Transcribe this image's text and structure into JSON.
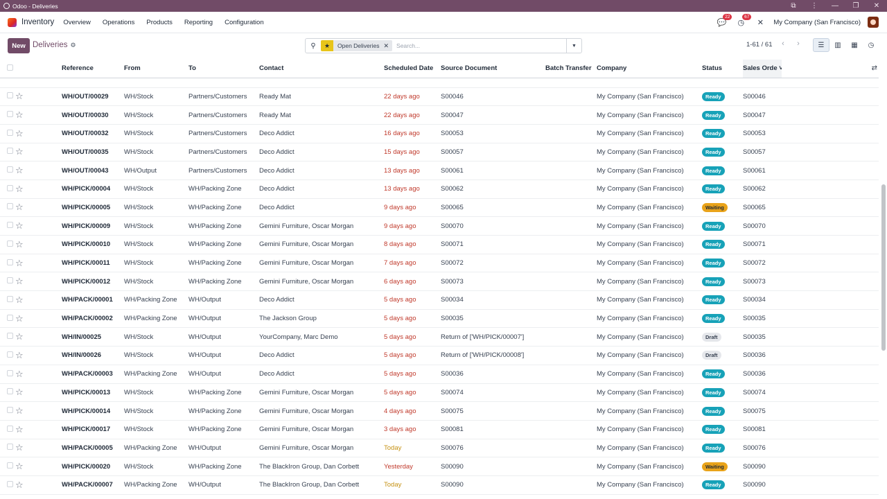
{
  "window": {
    "title": "Odoo - Deliveries"
  },
  "nav": {
    "app_name": "Inventory",
    "menu": [
      "Overview",
      "Operations",
      "Products",
      "Reporting",
      "Configuration"
    ],
    "messages_count": "22",
    "activities_count": "67",
    "company": "My Company (San Francisco)"
  },
  "control": {
    "new_label": "New",
    "breadcrumb": "Deliveries",
    "facet_label": "Open Deliveries",
    "search_placeholder": "Search...",
    "pager": "1-61 / 61"
  },
  "columns": [
    "Reference",
    "From",
    "To",
    "Contact",
    "Scheduled Date",
    "Source Document",
    "Batch Transfer",
    "Company",
    "Status",
    "Sales Orde"
  ],
  "rows": [
    {
      "ref": "WH/OUT/00029",
      "from": "WH/Stock",
      "to": "Partners/Customers",
      "contact": "Ready Mat",
      "date": "22 days ago",
      "date_kind": "overdue",
      "source": "S00046",
      "company": "My Company (San Francisco)",
      "status": "Ready",
      "status_kind": "ready",
      "so": "S00046"
    },
    {
      "ref": "WH/OUT/00030",
      "from": "WH/Stock",
      "to": "Partners/Customers",
      "contact": "Ready Mat",
      "date": "22 days ago",
      "date_kind": "overdue",
      "source": "S00047",
      "company": "My Company (San Francisco)",
      "status": "Ready",
      "status_kind": "ready",
      "so": "S00047"
    },
    {
      "ref": "WH/OUT/00032",
      "from": "WH/Stock",
      "to": "Partners/Customers",
      "contact": "Deco Addict",
      "date": "16 days ago",
      "date_kind": "overdue",
      "source": "S00053",
      "company": "My Company (San Francisco)",
      "status": "Ready",
      "status_kind": "ready",
      "so": "S00053"
    },
    {
      "ref": "WH/OUT/00035",
      "from": "WH/Stock",
      "to": "Partners/Customers",
      "contact": "Deco Addict",
      "date": "15 days ago",
      "date_kind": "overdue",
      "source": "S00057",
      "company": "My Company (San Francisco)",
      "status": "Ready",
      "status_kind": "ready",
      "so": "S00057"
    },
    {
      "ref": "WH/OUT/00043",
      "from": "WH/Output",
      "to": "Partners/Customers",
      "contact": "Deco Addict",
      "date": "13 days ago",
      "date_kind": "overdue",
      "source": "S00061",
      "company": "My Company (San Francisco)",
      "status": "Ready",
      "status_kind": "ready",
      "so": "S00061"
    },
    {
      "ref": "WH/PICK/00004",
      "from": "WH/Stock",
      "to": "WH/Packing Zone",
      "contact": "Deco Addict",
      "date": "13 days ago",
      "date_kind": "overdue",
      "source": "S00062",
      "company": "My Company (San Francisco)",
      "status": "Ready",
      "status_kind": "ready",
      "so": "S00062"
    },
    {
      "ref": "WH/PICK/00005",
      "from": "WH/Stock",
      "to": "WH/Packing Zone",
      "contact": "Deco Addict",
      "date": "9 days ago",
      "date_kind": "overdue",
      "source": "S00065",
      "company": "My Company (San Francisco)",
      "status": "Waiting",
      "status_kind": "waiting",
      "so": "S00065"
    },
    {
      "ref": "WH/PICK/00009",
      "from": "WH/Stock",
      "to": "WH/Packing Zone",
      "contact": "Gemini Furniture, Oscar Morgan",
      "date": "9 days ago",
      "date_kind": "overdue",
      "source": "S00070",
      "company": "My Company (San Francisco)",
      "status": "Ready",
      "status_kind": "ready",
      "so": "S00070"
    },
    {
      "ref": "WH/PICK/00010",
      "from": "WH/Stock",
      "to": "WH/Packing Zone",
      "contact": "Gemini Furniture, Oscar Morgan",
      "date": "8 days ago",
      "date_kind": "overdue",
      "source": "S00071",
      "company": "My Company (San Francisco)",
      "status": "Ready",
      "status_kind": "ready",
      "so": "S00071"
    },
    {
      "ref": "WH/PICK/00011",
      "from": "WH/Stock",
      "to": "WH/Packing Zone",
      "contact": "Gemini Furniture, Oscar Morgan",
      "date": "7 days ago",
      "date_kind": "overdue",
      "source": "S00072",
      "company": "My Company (San Francisco)",
      "status": "Ready",
      "status_kind": "ready",
      "so": "S00072"
    },
    {
      "ref": "WH/PICK/00012",
      "from": "WH/Stock",
      "to": "WH/Packing Zone",
      "contact": "Gemini Furniture, Oscar Morgan",
      "date": "6 days ago",
      "date_kind": "overdue",
      "source": "S00073",
      "company": "My Company (San Francisco)",
      "status": "Ready",
      "status_kind": "ready",
      "so": "S00073"
    },
    {
      "ref": "WH/PACK/00001",
      "from": "WH/Packing Zone",
      "to": "WH/Output",
      "contact": "Deco Addict",
      "date": "5 days ago",
      "date_kind": "overdue",
      "source": "S00034",
      "company": "My Company (San Francisco)",
      "status": "Ready",
      "status_kind": "ready",
      "so": "S00034"
    },
    {
      "ref": "WH/PACK/00002",
      "from": "WH/Packing Zone",
      "to": "WH/Output",
      "contact": "The Jackson Group",
      "date": "5 days ago",
      "date_kind": "overdue",
      "source": "S00035",
      "company": "My Company (San Francisco)",
      "status": "Ready",
      "status_kind": "ready",
      "so": "S00035"
    },
    {
      "ref": "WH/IN/00025",
      "from": "WH/Stock",
      "to": "WH/Output",
      "contact": "YourCompany, Marc Demo",
      "date": "5 days ago",
      "date_kind": "overdue",
      "source": "Return of ['WH/PICK/00007']",
      "company": "My Company (San Francisco)",
      "status": "Draft",
      "status_kind": "draft",
      "so": "S00035"
    },
    {
      "ref": "WH/IN/00026",
      "from": "WH/Stock",
      "to": "WH/Output",
      "contact": "Deco Addict",
      "date": "5 days ago",
      "date_kind": "overdue",
      "source": "Return of ['WH/PICK/00008']",
      "company": "My Company (San Francisco)",
      "status": "Draft",
      "status_kind": "draft",
      "so": "S00036"
    },
    {
      "ref": "WH/PACK/00003",
      "from": "WH/Packing Zone",
      "to": "WH/Output",
      "contact": "Deco Addict",
      "date": "5 days ago",
      "date_kind": "overdue",
      "source": "S00036",
      "company": "My Company (San Francisco)",
      "status": "Ready",
      "status_kind": "ready",
      "so": "S00036"
    },
    {
      "ref": "WH/PICK/00013",
      "from": "WH/Stock",
      "to": "WH/Packing Zone",
      "contact": "Gemini Furniture, Oscar Morgan",
      "date": "5 days ago",
      "date_kind": "overdue",
      "source": "S00074",
      "company": "My Company (San Francisco)",
      "status": "Ready",
      "status_kind": "ready",
      "so": "S00074"
    },
    {
      "ref": "WH/PICK/00014",
      "from": "WH/Stock",
      "to": "WH/Packing Zone",
      "contact": "Gemini Furniture, Oscar Morgan",
      "date": "4 days ago",
      "date_kind": "overdue",
      "source": "S00075",
      "company": "My Company (San Francisco)",
      "status": "Ready",
      "status_kind": "ready",
      "so": "S00075"
    },
    {
      "ref": "WH/PICK/00017",
      "from": "WH/Stock",
      "to": "WH/Packing Zone",
      "contact": "Gemini Furniture, Oscar Morgan",
      "date": "3 days ago",
      "date_kind": "overdue",
      "source": "S00081",
      "company": "My Company (San Francisco)",
      "status": "Ready",
      "status_kind": "ready",
      "so": "S00081"
    },
    {
      "ref": "WH/PACK/00005",
      "from": "WH/Packing Zone",
      "to": "WH/Output",
      "contact": "Gemini Furniture, Oscar Morgan",
      "date": "Today",
      "date_kind": "today",
      "source": "S00076",
      "company": "My Company (San Francisco)",
      "status": "Ready",
      "status_kind": "ready",
      "so": "S00076"
    },
    {
      "ref": "WH/PICK/00020",
      "from": "WH/Stock",
      "to": "WH/Packing Zone",
      "contact": "The BlackIron Group, Dan Corbett",
      "date": "Yesterday",
      "date_kind": "overdue",
      "source": "S00090",
      "company": "My Company (San Francisco)",
      "status": "Waiting",
      "status_kind": "waiting",
      "so": "S00090"
    },
    {
      "ref": "WH/PACK/00007",
      "from": "WH/Packing Zone",
      "to": "WH/Output",
      "contact": "The BlackIron Group, Dan Corbett",
      "date": "Today",
      "date_kind": "today",
      "source": "S00090",
      "company": "My Company (San Francisco)",
      "status": "Ready",
      "status_kind": "ready",
      "so": "S00090"
    }
  ],
  "colors": {
    "brand": "#714b67",
    "ready": "#17a2b8",
    "waiting": "#e9a31a",
    "overdue": "#c0392b",
    "today": "#c69214"
  }
}
